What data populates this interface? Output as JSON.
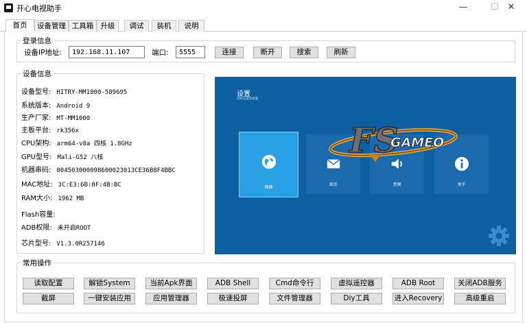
{
  "window": {
    "title": "开心电视助手",
    "minimize": "—",
    "maximize": "☐",
    "close": "✕"
  },
  "tabs": [
    "首页",
    "设备管理",
    "工具箱",
    "升级",
    "调试",
    "装机",
    "说明"
  ],
  "login": {
    "group_title": "登录信息",
    "ip_label": "设备IP地址:",
    "ip_value": "192.168.11.107",
    "port_label": "端口:",
    "port_value": "5555",
    "buttons": [
      "连接",
      "断开",
      "搜索",
      "刷新"
    ]
  },
  "device": {
    "group_title": "设备信息",
    "rows": [
      {
        "k": "设备型号:",
        "v": "HITRY-MM1000-589695"
      },
      {
        "k": "系统版本:",
        "v": "Android 9"
      },
      {
        "k": "生产厂家:",
        "v": "MT-MM1000"
      },
      {
        "k": "主板平台:",
        "v": "rk356x"
      },
      {
        "k": "CPU架构:",
        "v": "arm64-v8a 四核 1.8GHz"
      },
      {
        "k": "GPU型号:",
        "v": "Mali-G52 八核"
      },
      {
        "k": "机器串码:",
        "v": "004503000098600023013CE36B8F4BBC"
      },
      {
        "k": "MAC地址:",
        "v": "3C:E3:6B:8F:4B:BC"
      },
      {
        "k": "RAM大小:",
        "v": "1962 MB"
      },
      {
        "k": "Flash容量:",
        "v": ""
      },
      {
        "k": "ADB权限:",
        "v": "未开启ROOT"
      },
      {
        "k": "芯片型号:",
        "v": "V1.3.0R257146"
      }
    ]
  },
  "tv": {
    "title": "设置",
    "subtitle": "系统设置和配置",
    "tiles": [
      "网络",
      "显示",
      "音频",
      "关于"
    ],
    "logo_text": "GAMEO"
  },
  "ops": {
    "group_title": "常用操作",
    "row1": [
      "读取配置",
      "解锁System",
      "当前Apk界面",
      "ADB Shell",
      "Cmd命令行",
      "虚拟遥控器",
      "ADB  Root",
      "关闭ADB服务"
    ],
    "row2": [
      "截屏",
      "一键安装应用",
      "应用管理器",
      "极速投屏",
      "文件管理器",
      "Diy工具",
      "进入Recovery",
      "高级重启"
    ]
  },
  "colors": {
    "tv_bg": "#0d5fa3",
    "tile_selected": "#2aa0e6"
  }
}
